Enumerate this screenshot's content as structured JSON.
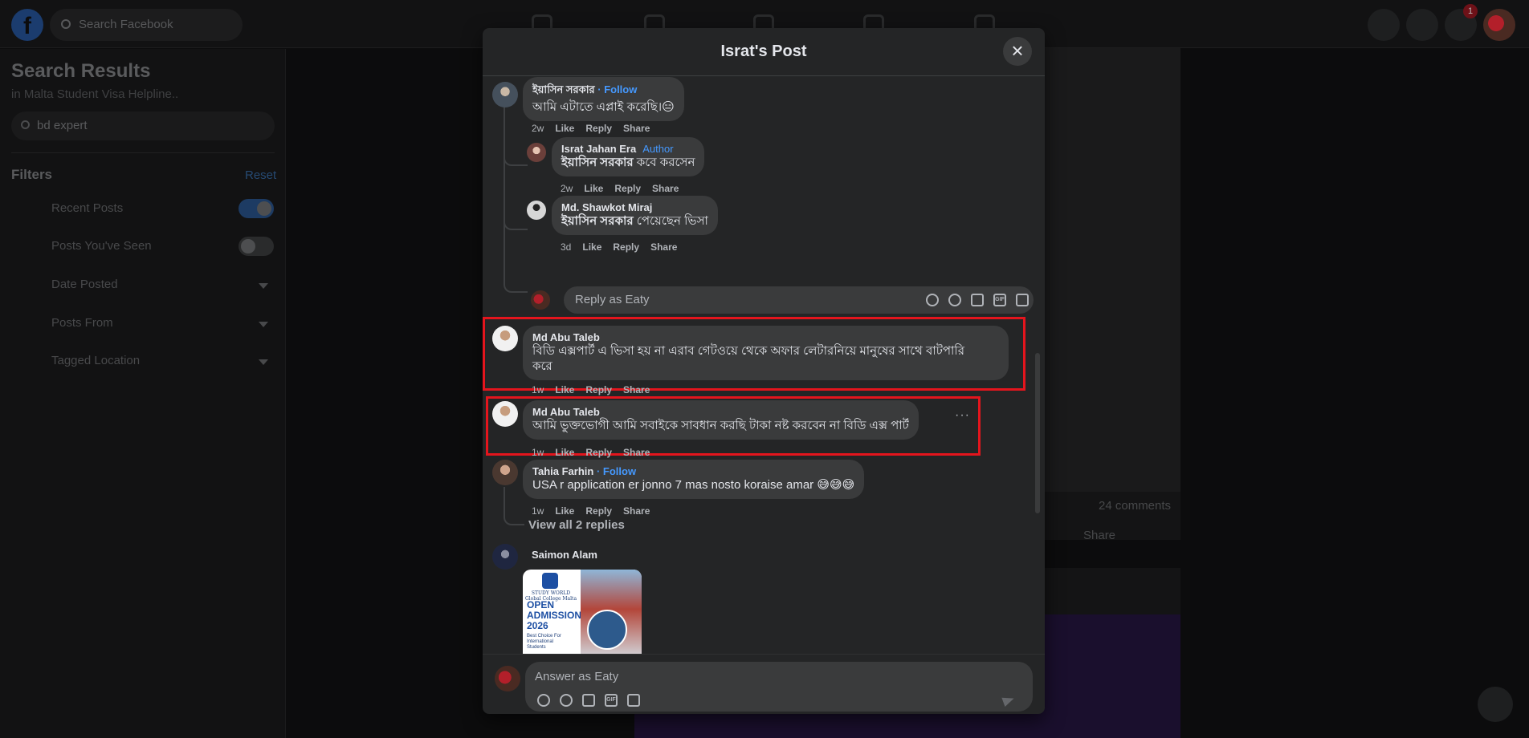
{
  "topbar": {
    "search_placeholder": "Search Facebook",
    "logo": "f",
    "notification_count": "1"
  },
  "left_panel": {
    "title": "Search Results",
    "subtitle": "in Malta Student Visa Helpline..",
    "search_value": "bd expert",
    "filters_label": "Filters",
    "reset_label": "Reset",
    "rows": [
      {
        "label": "Recent Posts"
      },
      {
        "label": "Posts You've Seen"
      },
      {
        "label": "Date Posted"
      },
      {
        "label": "Posts From"
      },
      {
        "label": "Tagged Location"
      }
    ]
  },
  "background": {
    "comments_count": "24 comments",
    "share_label": "Share"
  },
  "modal": {
    "title": "Israt's Post",
    "close_symbol": "×"
  },
  "comments": [
    {
      "name": "ইয়াসিন সরকার",
      "follow": "· Follow",
      "text": "আমি এটাতে এপ্লাই করেছি।😑",
      "time": "2w",
      "like": "Like",
      "reply": "Reply",
      "share": "Share"
    },
    {
      "name": "Israt Jahan Era",
      "badge": "Author",
      "mention": "ইয়াসিন সরকার",
      "text": " কবে করসেন",
      "time": "2w",
      "like": "Like",
      "reply": "Reply",
      "share": "Share"
    },
    {
      "name": "Md. Shawkot Miraj",
      "mention": "ইয়াসিন সরকার",
      "text": " পেয়েছেন ভিসা",
      "time": "3d",
      "like": "Like",
      "reply": "Reply",
      "share": "Share"
    },
    {
      "name": "Md Abu Taleb",
      "text_line1": "বিডি এক্সপার্ট এ ভিসা হয় না এরাব গেটওয়ে থেকে অফার লেটারনিয়ে মানুষের সাথে বাটপারি",
      "text_line2": "করে",
      "time": "1w",
      "like": "Like",
      "reply": "Reply",
      "share": "Share"
    },
    {
      "name": "Md Abu Taleb",
      "text": "আমি ভুক্তভোগী আমি সবাইকে সাবধান করছি টাকা নষ্ট করবেন না বিডি এক্স পার্ট",
      "time": "1w",
      "like": "Like",
      "reply": "Reply",
      "share": "Share",
      "more": "···"
    },
    {
      "name": "Tahia Farhin",
      "follow": "· Follow",
      "text": "USA r application er jonno 7 mas nosto koraise amar 😅😅😅",
      "time": "1w",
      "like": "Like",
      "reply": "Reply",
      "share": "Share"
    },
    {
      "name": "Saimon Alam"
    }
  ],
  "reply_box": {
    "placeholder": "Reply as Eaty"
  },
  "view_replies": "View all 2 replies",
  "ad": {
    "brand": "STUDY WORLD",
    "brand_sub": "Global College Malta",
    "headline_1": "OPEN",
    "headline_2": "ADMISSION",
    "headline_3": "2026",
    "tagline_1": "Best Choice For",
    "tagline_2": "International",
    "tagline_3": "Students"
  },
  "answer_box": {
    "placeholder": "Answer as Eaty"
  },
  "icons": {
    "gif": "GIF"
  },
  "colors": {
    "modal_bg": "#242526",
    "bubble_bg": "#3a3b3c",
    "link_blue": "#4599ff",
    "highlight_red": "#e4151d"
  }
}
